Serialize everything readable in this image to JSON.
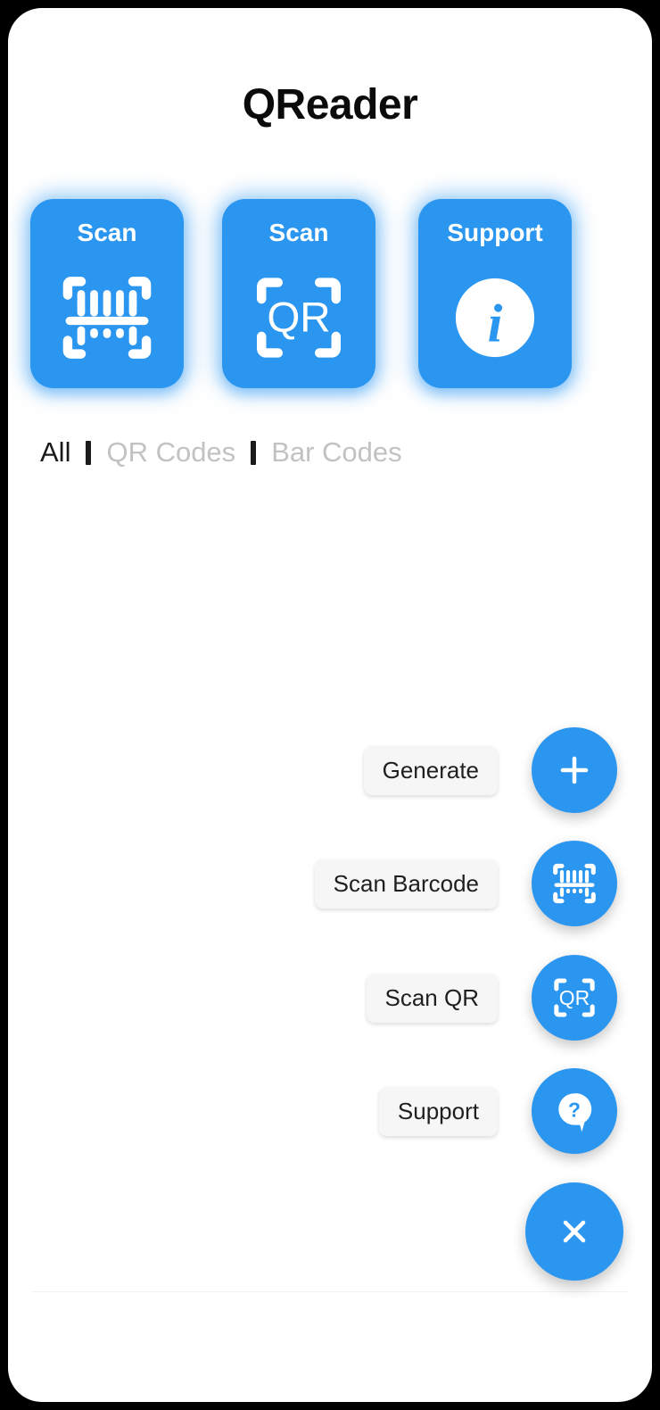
{
  "app": {
    "title": "QReader",
    "accent_color": "#2b96f0",
    "frame_color": "#000000",
    "screen_background": "#ffffff"
  },
  "tiles": [
    {
      "label": "Scan",
      "icon": "barcode-scan-icon",
      "name": "tile-scan-barcode"
    },
    {
      "label": "Scan",
      "icon": "qr-scan-icon",
      "name": "tile-scan-qr"
    },
    {
      "label": "Support",
      "icon": "info-circle-icon",
      "name": "tile-support"
    }
  ],
  "filters": {
    "items": [
      {
        "label": "All",
        "active": true
      },
      {
        "label": "QR Codes",
        "active": false
      },
      {
        "label": "Bar Codes",
        "active": false
      }
    ],
    "active_color": "#1a1a1a",
    "inactive_color": "#c2c2c2"
  },
  "speed_dial": {
    "expanded": true,
    "actions": [
      {
        "label": "Generate",
        "icon": "plus-icon"
      },
      {
        "label": "Scan Barcode",
        "icon": "barcode-scan-icon"
      },
      {
        "label": "Scan QR",
        "icon": "qr-scan-icon"
      },
      {
        "label": "Support",
        "icon": "question-bubble-icon"
      }
    ],
    "close_button": {
      "icon": "close-icon",
      "label": ""
    }
  }
}
